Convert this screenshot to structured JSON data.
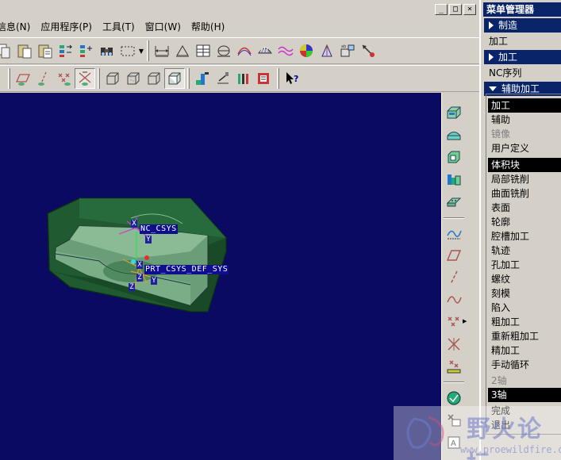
{
  "menubar": {
    "items": [
      "信息(N)",
      "应用程序(P)",
      "工具(T)",
      "窗口(W)",
      "帮助(H)"
    ]
  },
  "window_controls": [
    "_",
    "□",
    "×"
  ],
  "viewport": {
    "background": "#0a0a62",
    "labels": {
      "nc_csys": "NC_CSYS",
      "prt_csys": "PRT_CSYS_DEF_SYS"
    },
    "axis_tags": {
      "nc_x": "X",
      "nc_y": "Y",
      "prt_x": "X",
      "prt_y": "Y",
      "prt_z": "Z",
      "nc_z": "Z"
    }
  },
  "menu_manager": {
    "title": "菜单管理器",
    "headers": {
      "manufacture": "制造",
      "machining": "加工",
      "aux_machining": "辅助加工"
    },
    "plain": {
      "machining_item": "加工",
      "nc_sequence": "NC序列"
    },
    "sub_items": [
      {
        "label": "加工",
        "state": "selected"
      },
      {
        "label": "辅助",
        "state": "normal"
      },
      {
        "label": "镜像",
        "state": "disabled"
      },
      {
        "label": "用户定义",
        "state": "normal"
      },
      {
        "label": "体积块",
        "state": "selected"
      },
      {
        "label": "局部铣削",
        "state": "normal"
      },
      {
        "label": "曲面铣削",
        "state": "normal"
      },
      {
        "label": "表面",
        "state": "normal"
      },
      {
        "label": "轮廓",
        "state": "normal"
      },
      {
        "label": "腔槽加工",
        "state": "normal"
      },
      {
        "label": "轨迹",
        "state": "normal"
      },
      {
        "label": "孔加工",
        "state": "normal"
      },
      {
        "label": "螺纹",
        "state": "normal"
      },
      {
        "label": "刻模",
        "state": "normal"
      },
      {
        "label": "陷入",
        "state": "normal"
      },
      {
        "label": "粗加工",
        "state": "normal"
      },
      {
        "label": "重新粗加工",
        "state": "normal"
      },
      {
        "label": "精加工",
        "state": "normal"
      },
      {
        "label": "手动循环",
        "state": "normal"
      },
      {
        "label": "2轴",
        "state": "disabled"
      },
      {
        "label": "3轴",
        "state": "selected"
      },
      {
        "label": "完成",
        "state": "normal"
      },
      {
        "label": "退出",
        "state": "normal"
      }
    ]
  },
  "watermark": {
    "text": "野火论坛",
    "url": "www.proewildfire.cn"
  },
  "colors": {
    "title_bar": "#0a246a",
    "face": "#d4d0c8",
    "model_green": "#3d7a4a"
  }
}
